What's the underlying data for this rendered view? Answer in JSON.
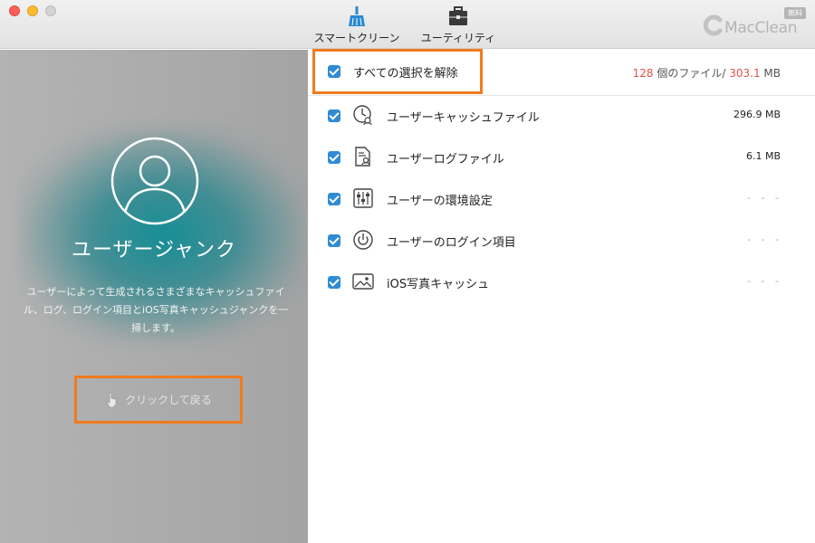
{
  "toolbar": {
    "smart_clean": "スマートクリーン",
    "utility": "ユーティリティ",
    "smart_clean_icon": "broom-icon",
    "utility_icon": "toolbox-icon"
  },
  "brand": {
    "name": "MacClean",
    "badge": "無料"
  },
  "left_panel": {
    "title": "ユーザージャンク",
    "description": "ユーザーによって生成されるさまざまなキャッシュファイル、ログ、ログイン項目とiOS写真キャッシュジャンクを一掃します。",
    "back_label": "クリックして戻る"
  },
  "right_panel": {
    "select_all_label": "すべての選択を解除",
    "summary": {
      "count": "128",
      "count_suffix": " 個のファイル/ ",
      "size": "303.1",
      "size_unit": " MB"
    },
    "items": [
      {
        "label": "ユーザーキャッシュファイル",
        "size": "296.9 MB",
        "icon": "cache-clock-icon",
        "checked": true
      },
      {
        "label": "ユーザーログファイル",
        "size": "6.1 MB",
        "icon": "log-document-icon",
        "checked": true
      },
      {
        "label": "ユーザーの環境設定",
        "size": "- - -",
        "icon": "preferences-sliders-icon",
        "checked": true
      },
      {
        "label": "ユーザーのログイン項目",
        "size": "- - -",
        "icon": "power-icon",
        "checked": true
      },
      {
        "label": "iOS写真キャッシュ",
        "size": "- - -",
        "icon": "photo-icon",
        "checked": true
      }
    ]
  },
  "colors": {
    "accent_orange": "#f07b1e",
    "checkbox_blue": "#2f8bd4",
    "highlight_red": "#e4504b",
    "glow_teal": "#0e8c94"
  }
}
